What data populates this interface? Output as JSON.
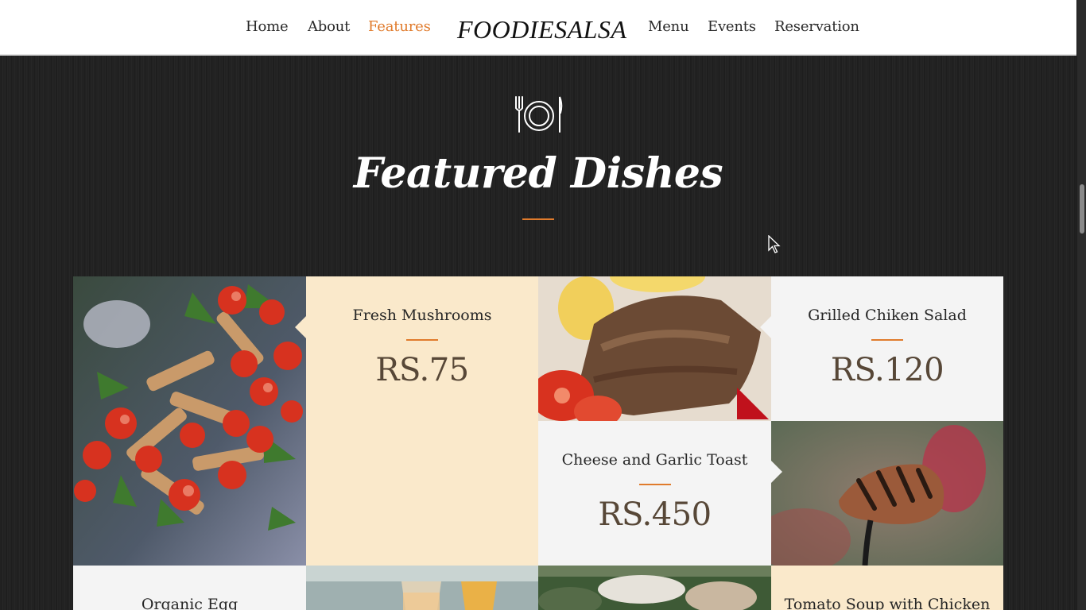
{
  "navbar": {
    "links_left": [
      "Home",
      "About",
      "Features"
    ],
    "brand": "FOODIESALSA",
    "links_right": [
      "Menu",
      "Events",
      "Reservation"
    ],
    "active": "Features",
    "active_color": "#e07b2c"
  },
  "section": {
    "icon": "plate-fork-knife-icon",
    "title": "Featured Dishes"
  },
  "dishes": [
    {
      "name": "Fresh Mushrooms",
      "price": "RS.75"
    },
    {
      "name": "Grilled Chiken Salad",
      "price": "RS.120"
    },
    {
      "name": "Cheese and Garlic Toast",
      "price": "RS.450"
    },
    {
      "name": "Organic Egg",
      "price": ""
    },
    {
      "name": "Tomato Soup with Chicken",
      "price": ""
    }
  ],
  "colors": {
    "accent": "#e07b2c",
    "cream": "#fae9cb",
    "light_gray": "#f4f4f4",
    "price_text": "#574737",
    "background": "#222222"
  }
}
